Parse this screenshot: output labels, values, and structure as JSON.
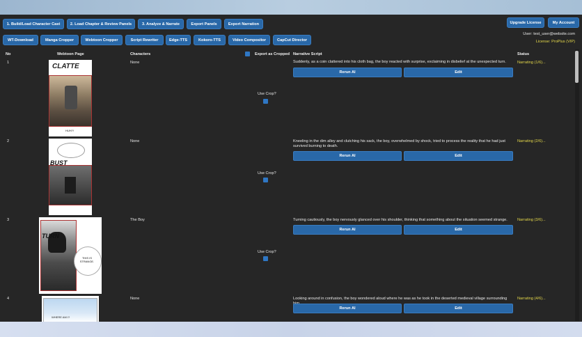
{
  "toolbar_row1": [
    "1. Build/Load Character Cast",
    "2. Load Chapter & Review Panels",
    "3. Analyze & Narrate",
    "Export Panels",
    "Export Narration"
  ],
  "account": {
    "upgrade": "Upgrade License",
    "my_account": "My Account",
    "user": "User: test_user@website.com",
    "license": "License: ProPlus (VIP)"
  },
  "toolbar_row2": [
    "WT-Download",
    "Manga Cropper",
    "Webtoon Cropper",
    "Script Rewriter",
    "Edge-TTS",
    "Kokoro-TTS",
    "Video Compositor",
    "CapCut Director"
  ],
  "table": {
    "headers": {
      "no": "No",
      "page": "Webtoon Page",
      "characters": "Characters",
      "export": "Export as Cropped",
      "script": "Narrative Script",
      "status": "Status"
    },
    "rerun_label": "Rerun AI",
    "edit_label": "Edit",
    "crop_label": "Use Crop?",
    "rows": [
      {
        "no": "1",
        "characters": "None",
        "script": "Suddenly, as a coin clattered into his cloth bag, the boy reacted with surprise, exclaiming in disbelief at the unexpected turn.",
        "status": "Narrating (1/6)...",
        "sfx": "CLATTE",
        "caption": "HUH?!"
      },
      {
        "no": "2",
        "characters": "None",
        "script": "Kneeling in the dim alley and clutching his sack, the boy, overwhelmed by shock, tried to process the reality that he had just survived burning to death.",
        "status": "Narrating (2/6)...",
        "sfx": "BUST",
        "caption": ""
      },
      {
        "no": "3",
        "characters": "The Boy",
        "script": "Turning cautiously, the boy nervously glanced over his shoulder, thinking that something about the situation seemed strange.",
        "status": "Narrating (3/6)...",
        "sfx": "TURN",
        "caption": "THIS IS STRANGE."
      },
      {
        "no": "4",
        "characters": "None",
        "script": "Looking around in confusion, the boy wondered aloud where he was as he took in the deserted medieval village surrounding him.",
        "status": "Narrating (4/6)...",
        "sfx": "",
        "caption": "WHERE AM I?"
      }
    ]
  }
}
